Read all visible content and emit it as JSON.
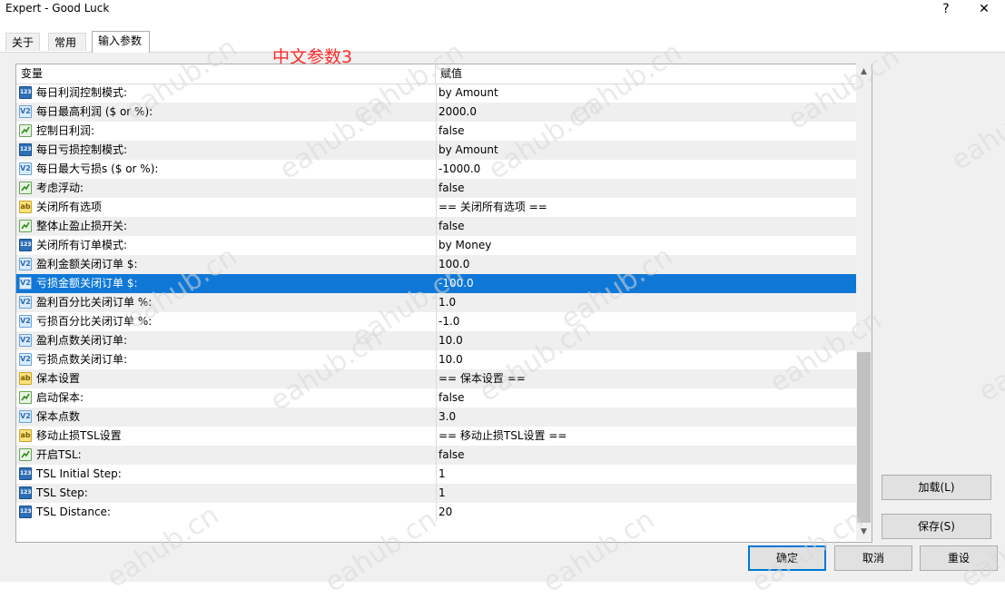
{
  "window": {
    "title": "Expert - Good Luck",
    "help_label": "?",
    "close_label": "✕"
  },
  "tabs": [
    {
      "label": "关于"
    },
    {
      "label": "常用"
    },
    {
      "label": "输入参数"
    }
  ],
  "annotation": "中文参数3",
  "table": {
    "headers": {
      "variable": "变量",
      "value": "赋值"
    },
    "rows": [
      {
        "type": "num",
        "badge": "123",
        "name": "每日利润控制模式:",
        "value": "by Amount"
      },
      {
        "type": "dbl",
        "badge": "V2",
        "name": "每日最高利润 ($ or %):",
        "value": "2000.0"
      },
      {
        "type": "bool",
        "badge": "",
        "name": "控制日利润:",
        "value": "false"
      },
      {
        "type": "num",
        "badge": "123",
        "name": "每日亏损控制模式:",
        "value": "by Amount"
      },
      {
        "type": "dbl",
        "badge": "V2",
        "name": "每日最大亏损s ($ or %):",
        "value": "-1000.0"
      },
      {
        "type": "bool",
        "badge": "",
        "name": "考虑浮动:",
        "value": "false"
      },
      {
        "type": "str",
        "badge": "ab",
        "name": "关闭所有选项",
        "value": "== 关闭所有选项 =="
      },
      {
        "type": "bool",
        "badge": "",
        "name": "整体止盈止损开关:",
        "value": "false"
      },
      {
        "type": "num",
        "badge": "123",
        "name": "关闭所有订单模式:",
        "value": "by Money"
      },
      {
        "type": "dbl",
        "badge": "V2",
        "name": "盈利金额关闭订单 $:",
        "value": "100.0"
      },
      {
        "type": "dbl",
        "badge": "V2",
        "name": "亏损金额关闭订单 $:",
        "value": "-100.0",
        "selected": true
      },
      {
        "type": "dbl",
        "badge": "V2",
        "name": "盈利百分比关闭订单 %:",
        "value": "1.0"
      },
      {
        "type": "dbl",
        "badge": "V2",
        "name": "亏损百分比关闭订单 %:",
        "value": "-1.0"
      },
      {
        "type": "dbl",
        "badge": "V2",
        "name": "盈利点数关闭订单:",
        "value": "10.0"
      },
      {
        "type": "dbl",
        "badge": "V2",
        "name": "亏损点数关闭订单:",
        "value": "10.0"
      },
      {
        "type": "str",
        "badge": "ab",
        "name": "保本设置",
        "value": "== 保本设置 =="
      },
      {
        "type": "bool",
        "badge": "",
        "name": "启动保本:",
        "value": "false"
      },
      {
        "type": "dbl",
        "badge": "V2",
        "name": "保本点数",
        "value": "3.0"
      },
      {
        "type": "str",
        "badge": "ab",
        "name": "移动止损TSL设置",
        "value": "== 移动止损TSL设置 =="
      },
      {
        "type": "bool",
        "badge": "",
        "name": "开启TSL:",
        "value": "false"
      },
      {
        "type": "num",
        "badge": "123",
        "name": "TSL Initial Step:",
        "value": "1"
      },
      {
        "type": "num",
        "badge": "123",
        "name": "TSL Step:",
        "value": "1"
      },
      {
        "type": "num",
        "badge": "123",
        "name": "TSL Distance:",
        "value": "20"
      }
    ]
  },
  "scrollbar": {
    "up_glyph": "▲",
    "down_glyph": "▼",
    "position_fraction": 1.0
  },
  "buttons": {
    "load": "加载(L)",
    "save": "保存(S)",
    "ok": "确定",
    "cancel": "取消",
    "reset": "重设"
  },
  "watermark": "eahub.cn",
  "colors": {
    "selection": "#0f78d7",
    "annotation": "#ff2a2a",
    "ok_border": "#0078d7"
  }
}
